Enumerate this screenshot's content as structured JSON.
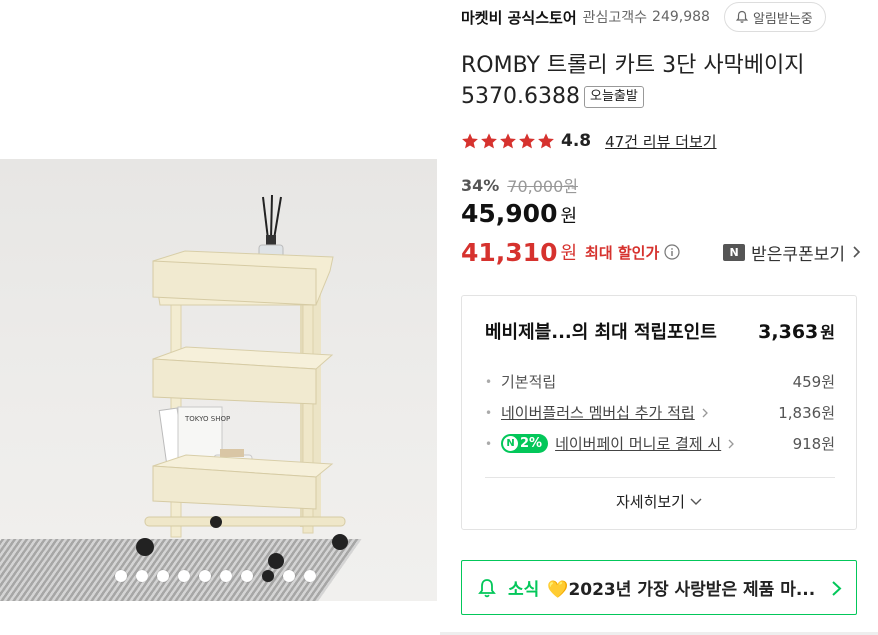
{
  "store": {
    "name": "마켓비 공식스토어",
    "follow_label": "관심고객수",
    "follow_count": "249,988",
    "alarm_button": "알림받는중"
  },
  "product": {
    "title": "ROMBY 트롤리 카트 3단 사막베이지 5370.6388",
    "delivery_badge": "오늘출발",
    "rating": "4.8",
    "rating_fraction": 0.96,
    "review_link": "47건 리뷰 더보기"
  },
  "pricing": {
    "discount_percent": "34%",
    "original_price": "70,000원",
    "price": "45,900",
    "price_unit": "원",
    "best_price": "41,310",
    "best_unit": "원",
    "best_label": "최대 할인가",
    "coupon_icon": "N",
    "coupon_label": "받은쿠폰보기"
  },
  "points": {
    "title": "베비제블...의 최대 적립포인트",
    "total": "3,363",
    "total_unit": "원",
    "items": [
      {
        "label": "기본적립",
        "value": "459원"
      },
      {
        "label": "네이버플러스 멤버십 추가 적립",
        "value": "1,836원"
      },
      {
        "badge": "2%",
        "label": "네이버페이 머니로 결제 시",
        "value": "918원"
      }
    ],
    "more_label": "자세히보기"
  },
  "gallery": {
    "dot_count": 10,
    "active_index": 7,
    "book_text": "TOKYO SHOP"
  },
  "news": {
    "tag": "소식",
    "text": "💛2023년 가장 사랑받은 제품 마..."
  },
  "colors": {
    "accent_red": "#d6322e",
    "naver_green": "#03c75a",
    "trolley": "#f1ead0"
  }
}
